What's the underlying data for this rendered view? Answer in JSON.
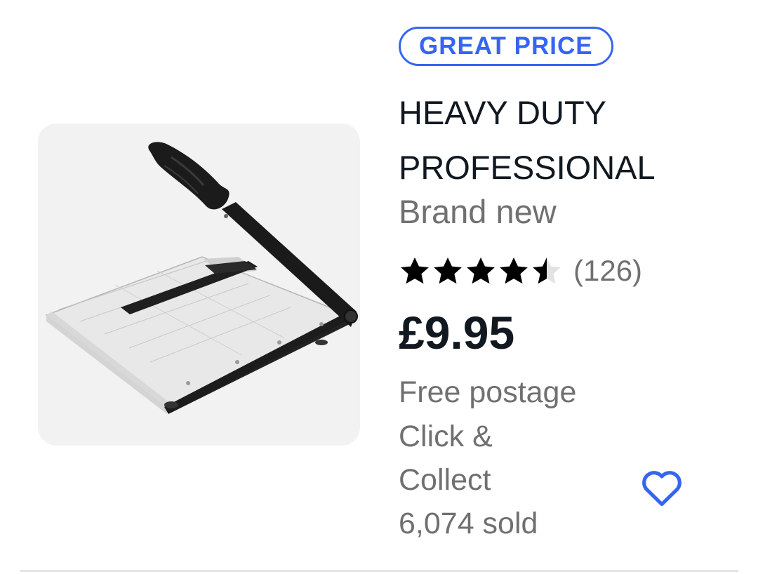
{
  "listing": {
    "badge": "GREAT PRICE",
    "title": "HEAVY DUTY PROFESSIONAL",
    "condition": "Brand new",
    "rating_value": 4.5,
    "rating_count": "(126)",
    "price": "£9.95",
    "postage": "Free postage",
    "collection": "Click & Collect",
    "sold": "6,074 sold",
    "image_icon": "paper-guillotine-cutter",
    "favorite_icon": "heart-outline"
  },
  "colors": {
    "accent": "#3665f3",
    "title_text": "#111820",
    "secondary_text": "#707070",
    "star_filled": "#000000",
    "star_empty": "#e2e2e2",
    "thumb_bg": "#f2f2f2"
  }
}
